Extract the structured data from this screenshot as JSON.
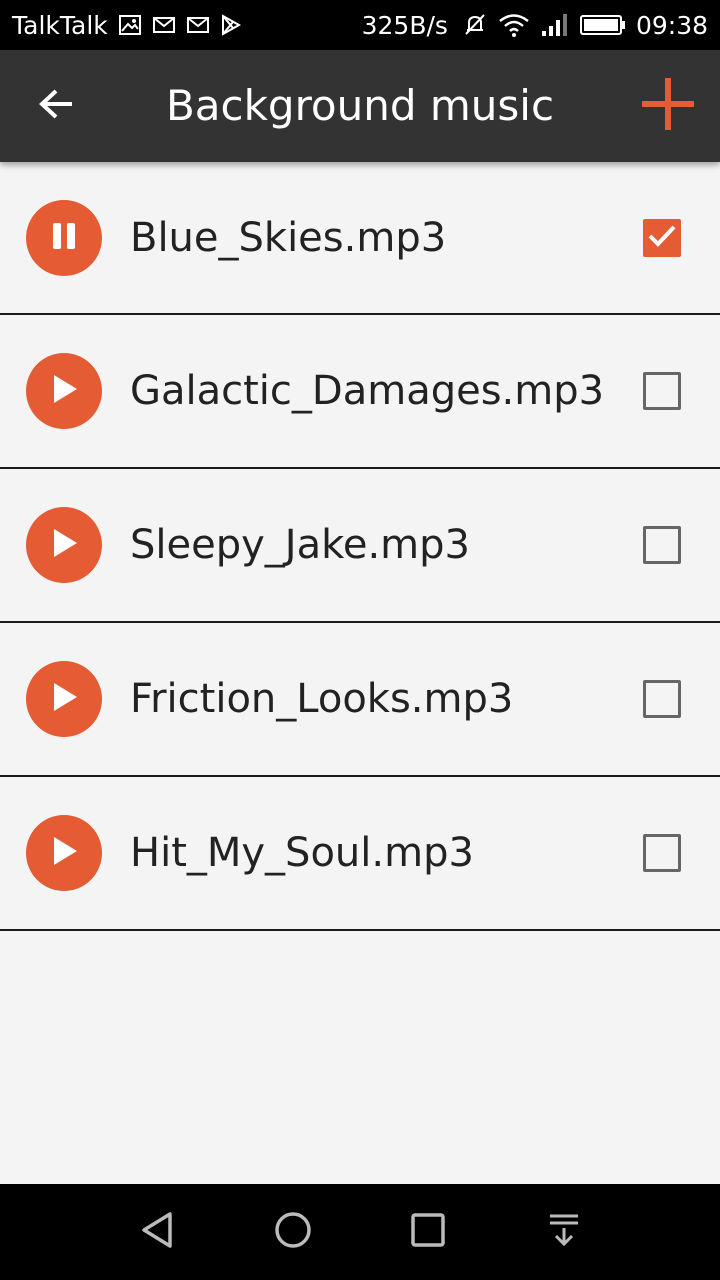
{
  "status_bar": {
    "carrier": "TalkTalk",
    "net_speed": "325B/s",
    "time": "09:38",
    "icons": [
      "gallery-icon",
      "mail-icon",
      "mail-icon",
      "play-store-icon",
      "mute-icon",
      "wifi-icon",
      "signal-icon",
      "battery-icon"
    ]
  },
  "app_bar": {
    "title": "Background music",
    "back_icon": "arrow-back-icon",
    "add_icon": "plus-icon"
  },
  "tracks": [
    {
      "name": "Blue_Skies.mp3",
      "state": "playing",
      "checked": true
    },
    {
      "name": "Galactic_Damages.mp3",
      "state": "stopped",
      "checked": false
    },
    {
      "name": "Sleepy_Jake.mp3",
      "state": "stopped",
      "checked": false
    },
    {
      "name": "Friction_Looks.mp3",
      "state": "stopped",
      "checked": false
    },
    {
      "name": "Hit_My_Soul.mp3",
      "state": "stopped",
      "checked": false
    }
  ],
  "nav_bar": {
    "buttons": [
      "back-triangle-icon",
      "home-circle-icon",
      "recents-square-icon",
      "notification-pull-icon"
    ]
  },
  "colors": {
    "accent": "#e45b34",
    "app_bar_bg": "#333333",
    "background": "#f4f4f4"
  }
}
